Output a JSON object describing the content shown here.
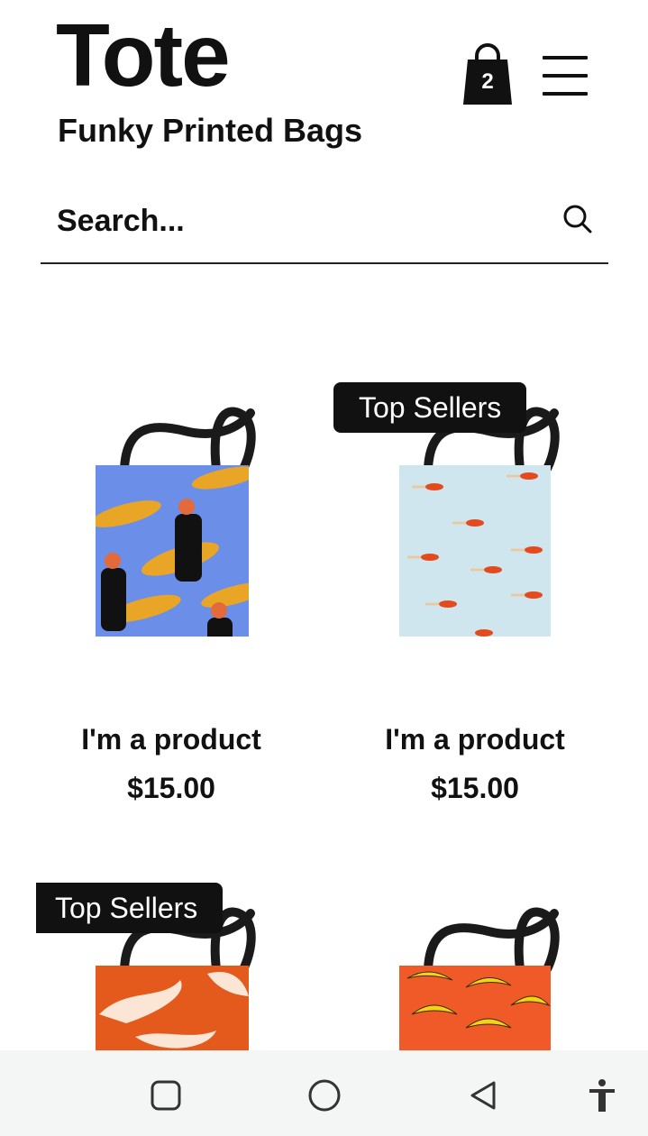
{
  "header": {
    "brand": "Tote",
    "tagline": "Funky Printed Bags",
    "cart_count": "2"
  },
  "search": {
    "placeholder": "Search..."
  },
  "products": [
    {
      "name": "I'm a product",
      "price": "$15.00",
      "print": "blue with tigers and women in black dresses"
    },
    {
      "name": "I'm a product",
      "price": "$15.00",
      "badge": "Top Sellers",
      "print": "light blue with swimmers"
    },
    {
      "badge": "Top Sellers",
      "print": "orange brush strokes"
    },
    {
      "print": "orange with bananas"
    }
  ],
  "colors": {
    "bag_blue": "#6b8ee8",
    "bag_lightblue": "#cfe6ef",
    "bag_orange": "#e35a1c",
    "bag_orange2": "#f05a28",
    "banana_yellow": "#f5d21a",
    "handle": "#1a1a1a",
    "badge_bg": "#111111",
    "navbar_bg": "#f4f5f5"
  },
  "system_nav": {
    "icons": [
      "square-recents-icon",
      "circle-home-icon",
      "triangle-back-icon",
      "accessibility-icon"
    ]
  }
}
